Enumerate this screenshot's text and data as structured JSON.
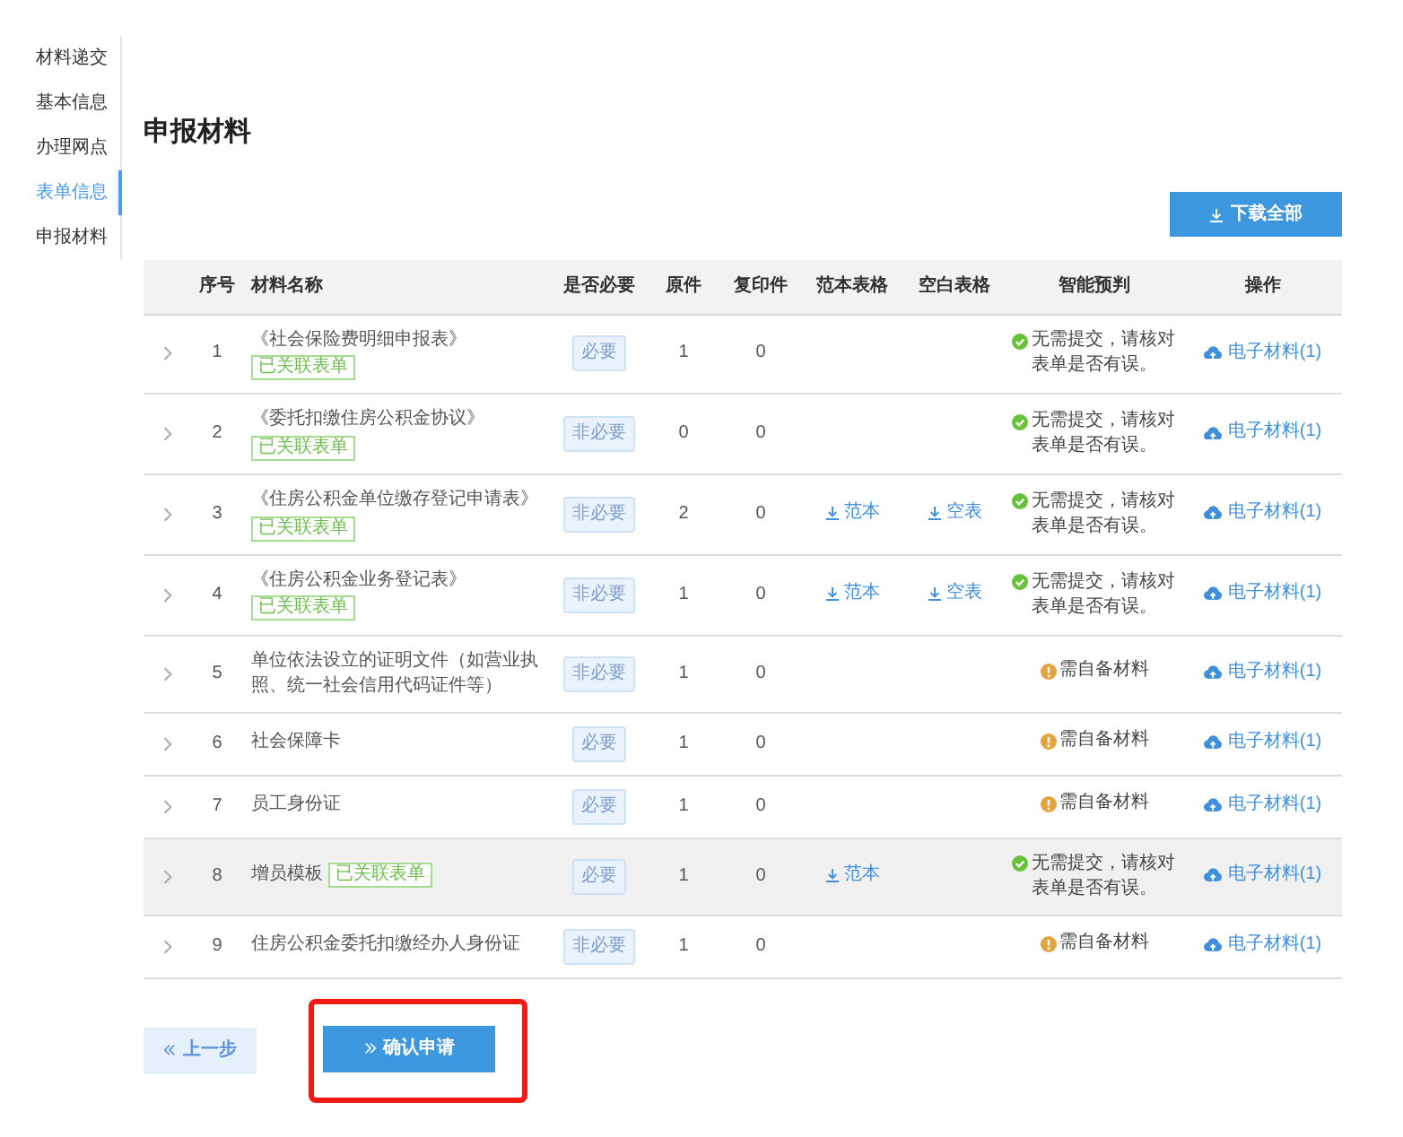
{
  "sidebar": {
    "items": [
      {
        "label": "材料递交",
        "selected": false
      },
      {
        "label": "基本信息",
        "selected": false
      },
      {
        "label": "办理网点",
        "selected": false
      },
      {
        "label": "表单信息",
        "selected": true
      },
      {
        "label": "申报材料",
        "selected": false
      }
    ]
  },
  "page_title": "申报材料",
  "download_all_button": {
    "label": "下载全部"
  },
  "table": {
    "columns": [
      "序号",
      "材料名称",
      "是否必要",
      "原件",
      "复印件",
      "范本表格",
      "空白表格",
      "智能预判",
      "操作"
    ],
    "rows": [
      {
        "index": "1",
        "name": "《社会保险费明细申报表》",
        "tag": "已关联表单",
        "necessity": "必要",
        "originals": "1",
        "copies": "0",
        "judgment": {
          "kind": "ok",
          "text": "无需提交，请核对表单是否有误。"
        },
        "action": "电子材料(1)",
        "highlighted": false
      },
      {
        "index": "2",
        "name": "《委托扣缴住房公积金协议》",
        "tag": "已关联表单",
        "necessity": "非必要",
        "originals": "0",
        "copies": "0",
        "judgment": {
          "kind": "ok",
          "text": "无需提交，请核对表单是否有误。"
        },
        "action": "电子材料(1)",
        "highlighted": false
      },
      {
        "index": "3",
        "name": "《住房公积金单位缴存登记申请表》",
        "tag": "已关联表单",
        "necessity": "非必要",
        "originals": "2",
        "copies": "0",
        "sample": "范本",
        "blank": "空表",
        "judgment": {
          "kind": "ok",
          "text": "无需提交，请核对表单是否有误。"
        },
        "action": "电子材料(1)",
        "highlighted": false
      },
      {
        "index": "4",
        "name": "《住房公积金业务登记表》",
        "tag": "已关联表单",
        "necessity": "非必要",
        "originals": "1",
        "copies": "0",
        "sample": "范本",
        "blank": "空表",
        "judgment": {
          "kind": "ok",
          "text": "无需提交，请核对表单是否有误。"
        },
        "action": "电子材料(1)",
        "highlighted": false
      },
      {
        "index": "5",
        "name": "单位依法设立的证明文件（如营业执照、统一社会信用代码证件等）",
        "necessity": "非必要",
        "originals": "1",
        "copies": "0",
        "judgment": {
          "kind": "warn",
          "text": "需自备材料"
        },
        "action": "电子材料(1)",
        "highlighted": false
      },
      {
        "index": "6",
        "name": "社会保障卡",
        "necessity": "必要",
        "originals": "1",
        "copies": "0",
        "judgment": {
          "kind": "warn",
          "text": "需自备材料"
        },
        "action": "电子材料(1)",
        "highlighted": false
      },
      {
        "index": "7",
        "name": "员工身份证",
        "necessity": "必要",
        "originals": "1",
        "copies": "0",
        "judgment": {
          "kind": "warn",
          "text": "需自备材料"
        },
        "action": "电子材料(1)",
        "highlighted": false
      },
      {
        "index": "8",
        "name": "增员模板",
        "tag": "已关联表单",
        "necessity": "必要",
        "originals": "1",
        "copies": "0",
        "sample": "范本",
        "judgment": {
          "kind": "ok",
          "text": "无需提交，请核对表单是否有误。"
        },
        "action": "电子材料(1)",
        "highlighted": true
      },
      {
        "index": "9",
        "name": "住房公积金委托扣缴经办人身份证",
        "necessity": "非必要",
        "originals": "1",
        "copies": "0",
        "judgment": {
          "kind": "warn",
          "text": "需自备材料"
        },
        "action": "电子材料(1)",
        "highlighted": false
      }
    ]
  },
  "buttons": [
    {
      "kind": "back",
      "label": "上一步",
      "highlighted": false
    },
    {
      "kind": "confirm",
      "label": "确认申请",
      "highlighted": true
    }
  ]
}
